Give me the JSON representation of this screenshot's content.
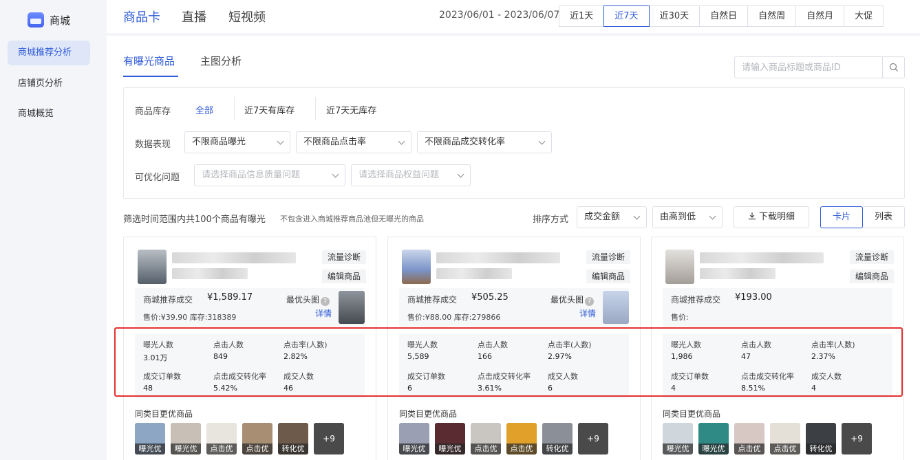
{
  "sidebar": {
    "brand": "商城",
    "items": [
      {
        "label": "商城推荐分析",
        "active": true
      },
      {
        "label": "店铺页分析",
        "active": false
      },
      {
        "label": "商城概览",
        "active": false
      }
    ]
  },
  "top_tabs": [
    {
      "label": "商品卡",
      "active": true
    },
    {
      "label": "直播",
      "active": false
    },
    {
      "label": "短视频",
      "active": false
    }
  ],
  "date_range": "2023/06/01 - 2023/06/07",
  "periods": [
    {
      "label": "近1天",
      "active": false
    },
    {
      "label": "近7天",
      "active": true
    },
    {
      "label": "近30天",
      "active": false
    },
    {
      "label": "自然日",
      "active": false
    },
    {
      "label": "自然周",
      "active": false
    },
    {
      "label": "自然月",
      "active": false
    },
    {
      "label": "大促",
      "active": false
    }
  ],
  "sub_tabs": [
    {
      "label": "有曝光商品",
      "active": true
    },
    {
      "label": "主图分析",
      "active": false
    }
  ],
  "search": {
    "placeholder": "请输入商品标题或商品ID",
    "value": ""
  },
  "filters": {
    "stock_label": "商品库存",
    "stock_options": [
      {
        "label": "全部",
        "active": true
      },
      {
        "label": "近7天有库存",
        "active": false
      },
      {
        "label": "近7天无库存",
        "active": false
      }
    ],
    "perf_label": "数据表现",
    "perf_selects": [
      "不限商品曝光",
      "不限商品点击率",
      "不限商品成交转化率"
    ],
    "issue_label": "可优化问题",
    "issue_selects": [
      "请选择商品信息质量问题",
      "请选择商品权益问题"
    ]
  },
  "summary": {
    "text": "筛选时间范围内共100个商品有曝光",
    "note": "不包含进入商城推荐商品池但无曝光的商品"
  },
  "sort": {
    "label": "排序方式",
    "field": "成交金额",
    "order": "由高到低",
    "download": "下载明细",
    "view_card": "卡片",
    "view_list": "列表"
  },
  "card_common": {
    "diagnose_btn": "流量诊断",
    "edit_btn": "编辑商品",
    "gmv_label": "商城推荐成交",
    "best_img_label": "最优头图",
    "detail_link": "详情",
    "better_label": "同类目更优商品",
    "metric_labels": [
      "曝光人数",
      "点击人数",
      "点击率(人数)",
      "成交订单数",
      "点击成交转化率",
      "成交人数"
    ]
  },
  "cards": [
    {
      "gmv": "¥1,589.17",
      "price_line": "售价:¥39.90  库存:318389",
      "metric_values": [
        "3.01万",
        "849",
        "2.82%",
        "48",
        "5.42%",
        "46"
      ],
      "better_tags": [
        "曝光优",
        "曝光优",
        "点击优",
        "点击优",
        "转化优"
      ],
      "better_colors": [
        "#8da6c4",
        "#c8c0b6",
        "#e8e4de",
        "#a88f74",
        "#6d5a4a"
      ],
      "more": "+9"
    },
    {
      "gmv": "¥505.25",
      "price_line": "售价:¥88.00  库存:279866",
      "metric_values": [
        "5,589",
        "166",
        "2.97%",
        "6",
        "3.61%",
        "6"
      ],
      "better_tags": [
        "曝光优",
        "曝光优",
        "点击优",
        "点击优",
        "转化优"
      ],
      "better_colors": [
        "#9a9fb4",
        "#5a2c32",
        "#c9c6c2",
        "#e0a02a",
        "#8a8f98"
      ],
      "more": "+9"
    },
    {
      "gmv": "¥193.00",
      "price_line": "售价:",
      "metric_values": [
        "1,986",
        "47",
        "2.37%",
        "4",
        "8.51%",
        "4"
      ],
      "better_tags": [
        "曝光优",
        "曝光优",
        "点击优",
        "点击优",
        "转化优"
      ],
      "better_colors": [
        "#cfd6dc",
        "#2f8a86",
        "#d8c8c4",
        "#e4e0d8",
        "#3c3f44"
      ],
      "more": "+9"
    }
  ]
}
